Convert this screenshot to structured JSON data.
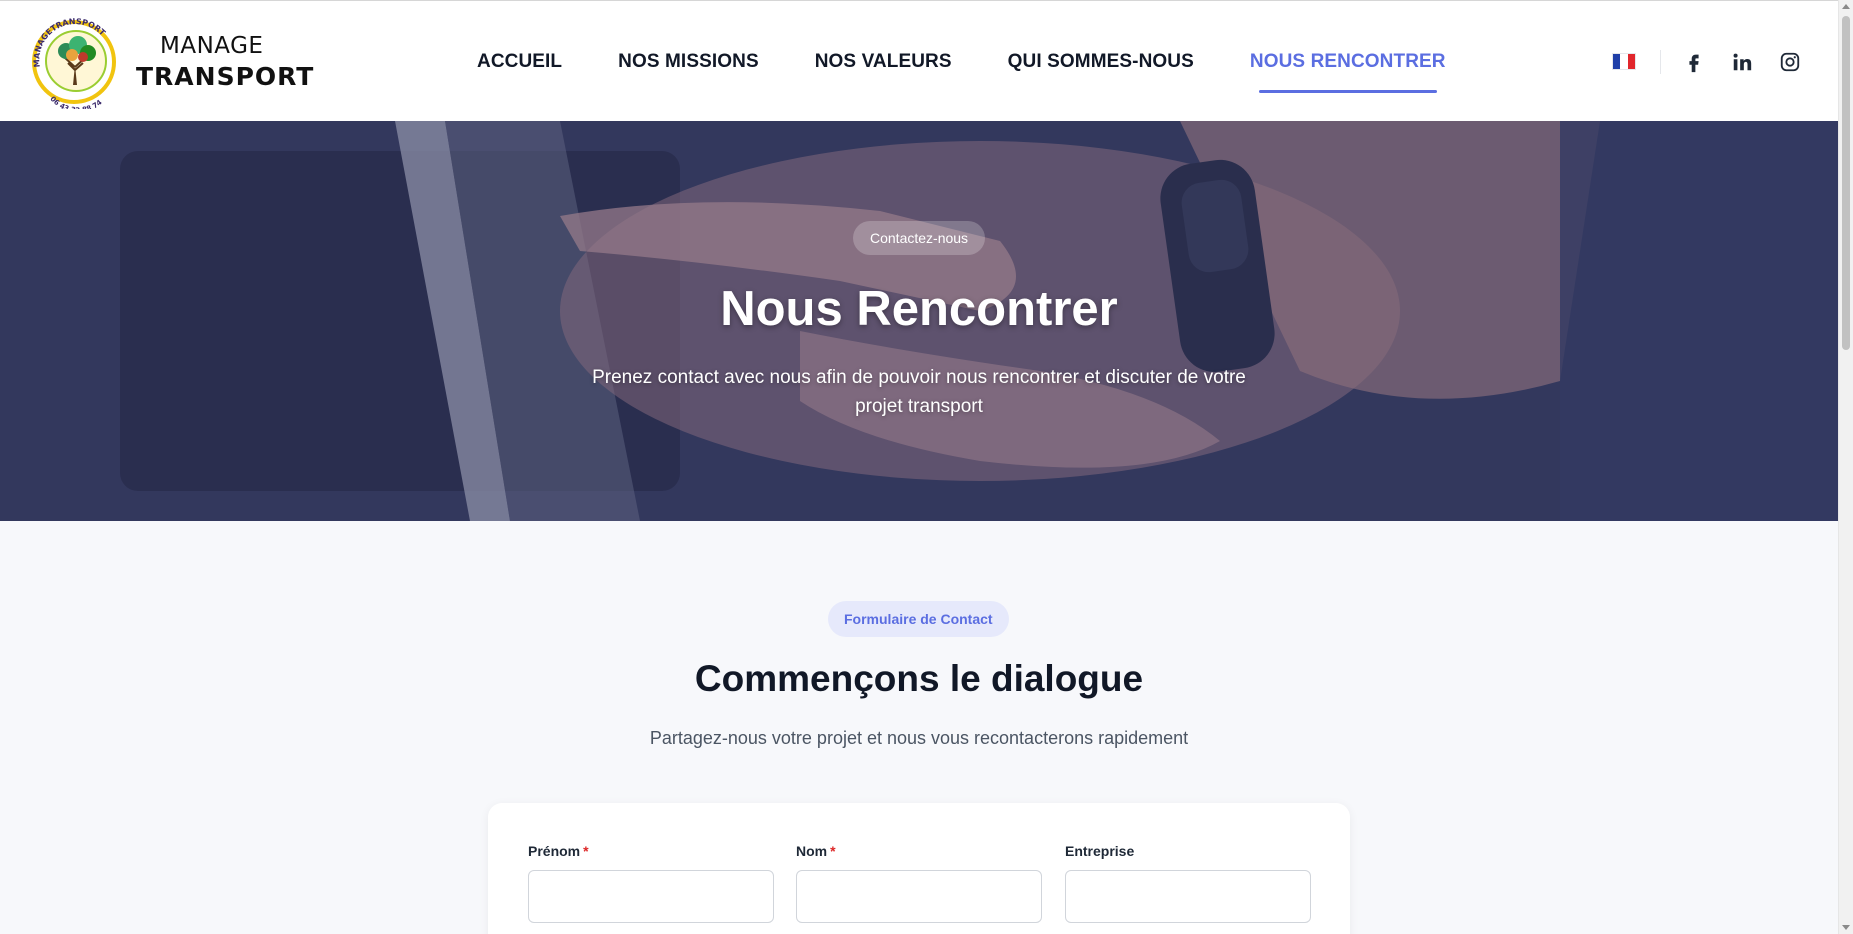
{
  "brand": {
    "line1": "MANAGE",
    "line2": "TRANSPORT",
    "badge_text": "MANAGETRANSPORT",
    "badge_phone": "06 43 32 88 74"
  },
  "nav": {
    "items": [
      {
        "label": "ACCUEIL"
      },
      {
        "label": "NOS MISSIONS"
      },
      {
        "label": "NOS VALEURS"
      },
      {
        "label": "QUI SOMMES-NOUS"
      },
      {
        "label": "NOUS RENCONTRER"
      }
    ],
    "active_index": 4
  },
  "header_icons": {
    "language": "french-flag-icon",
    "social": [
      "facebook-icon",
      "linkedin-icon",
      "instagram-icon"
    ]
  },
  "hero": {
    "chip": "Contactez-nous",
    "title": "Nous Rencontrer",
    "subtitle": "Prenez contact avec nous afin de pouvoir nous rencontrer et discuter de votre projet transport"
  },
  "contact": {
    "chip": "Formulaire de Contact",
    "title": "Commençons le dialogue",
    "subtitle": "Partagez-nous votre projet et nous vous recontacterons rapidement",
    "fields": [
      {
        "label": "Prénom",
        "required": "*",
        "value": ""
      },
      {
        "label": "Nom",
        "required": "*",
        "value": ""
      },
      {
        "label": "Entreprise",
        "required": "",
        "value": ""
      }
    ]
  },
  "colors": {
    "accent": "#5b6ee1",
    "required": "#dc2626",
    "text": "#111827"
  }
}
